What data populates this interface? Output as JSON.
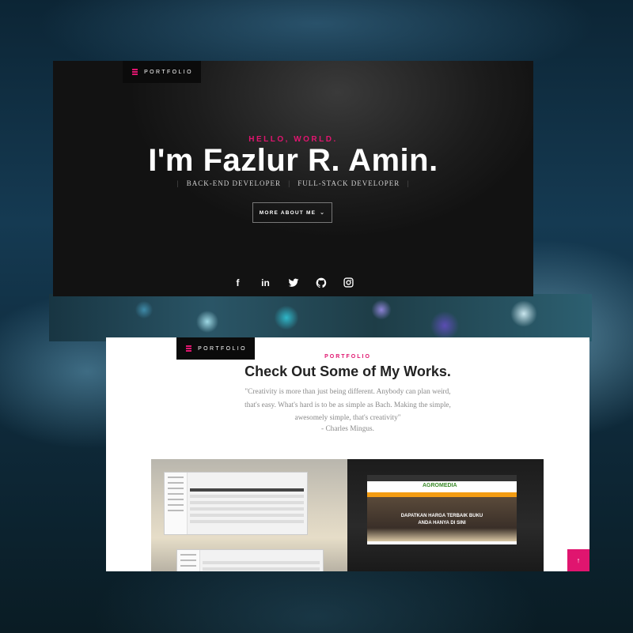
{
  "hero": {
    "nav_label": "PORTFOLIO",
    "greeting": "HELLO, WORLD.",
    "name": "I'm Fazlur R. Amin.",
    "roles": [
      "BACK-END DEVELOPER",
      "FULL-STACK DEVELOPER"
    ],
    "more_button": "MORE ABOUT ME",
    "socials": [
      {
        "icon": "facebook-icon",
        "glyph": "f"
      },
      {
        "icon": "linkedin-icon",
        "glyph": "in"
      },
      {
        "icon": "twitter-icon",
        "glyph": "🐦"
      },
      {
        "icon": "github-icon",
        "glyph": "⌬"
      },
      {
        "icon": "instagram-icon",
        "glyph": "◙"
      }
    ]
  },
  "works": {
    "nav_label": "PORTFOLIO",
    "kicker": "PORTFOLIO",
    "title": "Check Out Some of My Works.",
    "quote_lines": [
      "\"Creativity is more than just being different. Anybody can plan weird,",
      "that's easy. What's hard is to be as simple as Bach. Making the simple,",
      "awesomely simple, that's creativity\""
    ],
    "quote_author": "- Charles Mingus.",
    "project_right": {
      "logo": "AGROMEDIA",
      "banner_line1": "DAPATKAN HARGA TERBAIK BUKU",
      "banner_line2": "ANDA HANYA DI SINI"
    },
    "back_to_top": "↑"
  },
  "colors": {
    "accent": "#e0156f",
    "hero_bg": "#121212",
    "page_bg": "#0d2230"
  }
}
